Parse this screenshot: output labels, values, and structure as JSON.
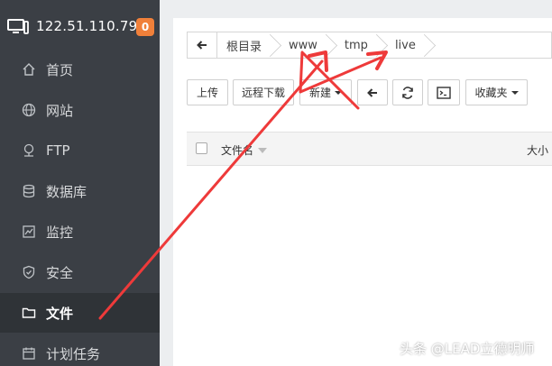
{
  "header": {
    "ip": "122.51.110.79",
    "badge": "0"
  },
  "sidebar": {
    "items": [
      {
        "label": "首页",
        "icon": "home-icon"
      },
      {
        "label": "网站",
        "icon": "globe-icon"
      },
      {
        "label": "FTP",
        "icon": "ftp-icon"
      },
      {
        "label": "数据库",
        "icon": "database-icon"
      },
      {
        "label": "监控",
        "icon": "monitor-chart-icon"
      },
      {
        "label": "安全",
        "icon": "shield-icon"
      },
      {
        "label": "文件",
        "icon": "folder-icon",
        "active": true
      },
      {
        "label": "计划任务",
        "icon": "calendar-icon"
      }
    ]
  },
  "breadcrumb": {
    "segments": [
      "根目录",
      "www",
      "tmp",
      "live"
    ]
  },
  "toolbar": {
    "upload": "上传",
    "remote_download": "远程下载",
    "new": "新建",
    "favorites": "收藏夹"
  },
  "table": {
    "col_name": "文件名",
    "col_size": "大小"
  },
  "watermark": "头条 @LEAD立德明师",
  "colors": {
    "sidebar_bg": "#3b3f45",
    "badge": "#f0803a",
    "annotation_arrow": "#ee3a3a"
  }
}
